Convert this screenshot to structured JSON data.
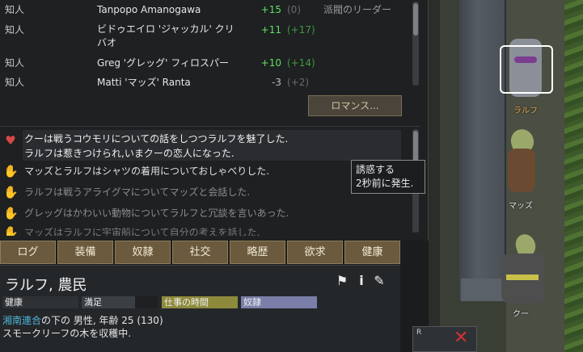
{
  "relations": [
    {
      "kind": "知人",
      "name": "Tanpopo Amanogawa",
      "op": "+15",
      "op_class": "pos",
      "op2": "(0)",
      "op2_class": "dim",
      "role": "派閥のリーダー"
    },
    {
      "kind": "知人",
      "name": "ビドゥエイロ 'ジャッカル' クリバオ",
      "op": "+11",
      "op_class": "pos",
      "op2": "(+17)",
      "op2_class": "pos-dim",
      "role": ""
    },
    {
      "kind": "知人",
      "name": "Greg 'グレッグ' フィロスパー",
      "op": "+10",
      "op_class": "pos",
      "op2": "(+14)",
      "op2_class": "pos-dim",
      "role": ""
    },
    {
      "kind": "知人",
      "name": "Matti 'マッズ' Ranta",
      "op": "-3",
      "op_class": "neu",
      "op2": "(+2)",
      "op2_class": "dim",
      "role": ""
    }
  ],
  "romance_button": "ロマンス...",
  "log": [
    {
      "icon": "heart-icon",
      "line1": "クーは戦うコウモリについての話をしつつラルフを魅了した.",
      "line2": "ラルフは惹きつけられ,いまクーの恋人になった."
    },
    {
      "icon": "hand-icon",
      "line1": "マッズとラルフはシャツの着用についておしゃべりした."
    },
    {
      "icon": "hand-icon",
      "line1": "ラルフは戦うアライグマについてマッズと会話した."
    },
    {
      "icon": "hand-icon",
      "line1": "グレッグはかわいい動物についてラルフと冗談を言いあった."
    },
    {
      "icon": "hand-icon",
      "line1": "マッズはラルフに宇宙船について自分の考えを話した."
    }
  ],
  "tooltip": {
    "line1": "誘惑する",
    "line2": "2秒前に発生."
  },
  "tabs": [
    "ログ",
    "装備",
    "奴隷",
    "社交",
    "略歴",
    "欲求",
    "健康"
  ],
  "pawn": {
    "name": "ラルフ",
    "sep": ",",
    "role": "農民",
    "health_label": "健康",
    "mood_label": "満足",
    "work_label": "仕事の時間",
    "slave_label": "奴隷",
    "faction": "湘南連合",
    "bio_rest": "の下の 男性, 年齢 25 (130)",
    "activity": "スモークリーフの木を収穫中."
  },
  "world": {
    "pawns": [
      "ラルフ",
      "マッズ",
      "クー"
    ],
    "rotate_key": "R"
  },
  "colors": {
    "tab_bg": "#6b5a3d",
    "positive": "#5ee05e",
    "faction": "#4fb4d8",
    "work_bar": "#8e8a3c",
    "slave_bar": "#7a7ea8"
  }
}
